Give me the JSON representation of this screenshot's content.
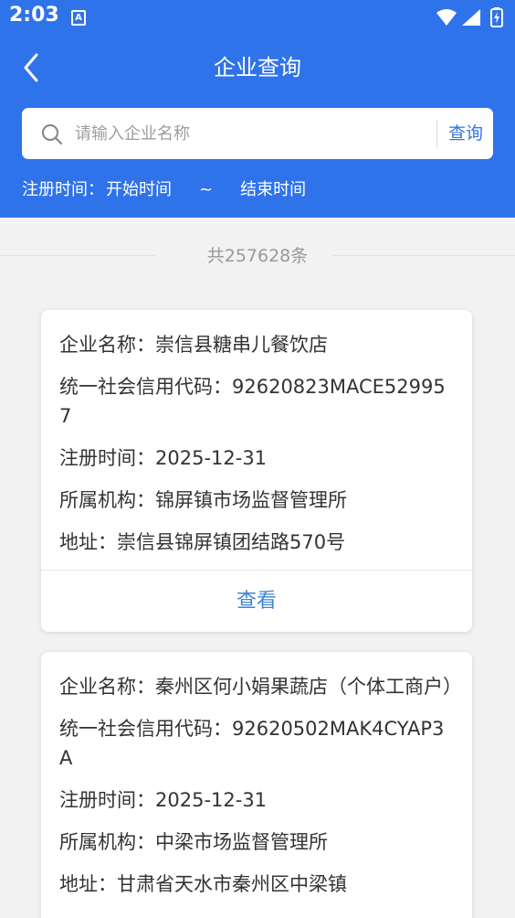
{
  "status_bar": {
    "time": "2:03",
    "notification_icon": "a-letter-icon"
  },
  "header": {
    "title": "企业查询",
    "back_icon": "chevron-left-icon"
  },
  "search": {
    "placeholder": "请输入企业名称",
    "value": "",
    "button_label": "查询"
  },
  "date_filter": {
    "label": "注册时间：",
    "start": "开始时间",
    "separator": "~",
    "end": "结束时间"
  },
  "result_count": "共257628条",
  "cards": [
    {
      "name": "企业名称：崇信县糖串儿餐饮店",
      "credit_code": "统一社会信用代码：92620823MACE529957",
      "reg_date": "注册时间：2025-12-31",
      "org": "所属机构：锦屏镇市场监督管理所",
      "address": "地址：崇信县锦屏镇团结路570号",
      "action": "查看"
    },
    {
      "name": "企业名称：秦州区何小娟果蔬店（个体工商户）",
      "credit_code": "统一社会信用代码：92620502MAK4CYAP3A",
      "reg_date": "注册时间：2025-12-31",
      "org": "所属机构：中梁市场监督管理所",
      "address": "地址：甘肃省天水市秦州区中梁镇"
    }
  ],
  "colors": {
    "brand": "#2f73ea",
    "link": "#3f84d6",
    "background": "#f2f2f2"
  }
}
